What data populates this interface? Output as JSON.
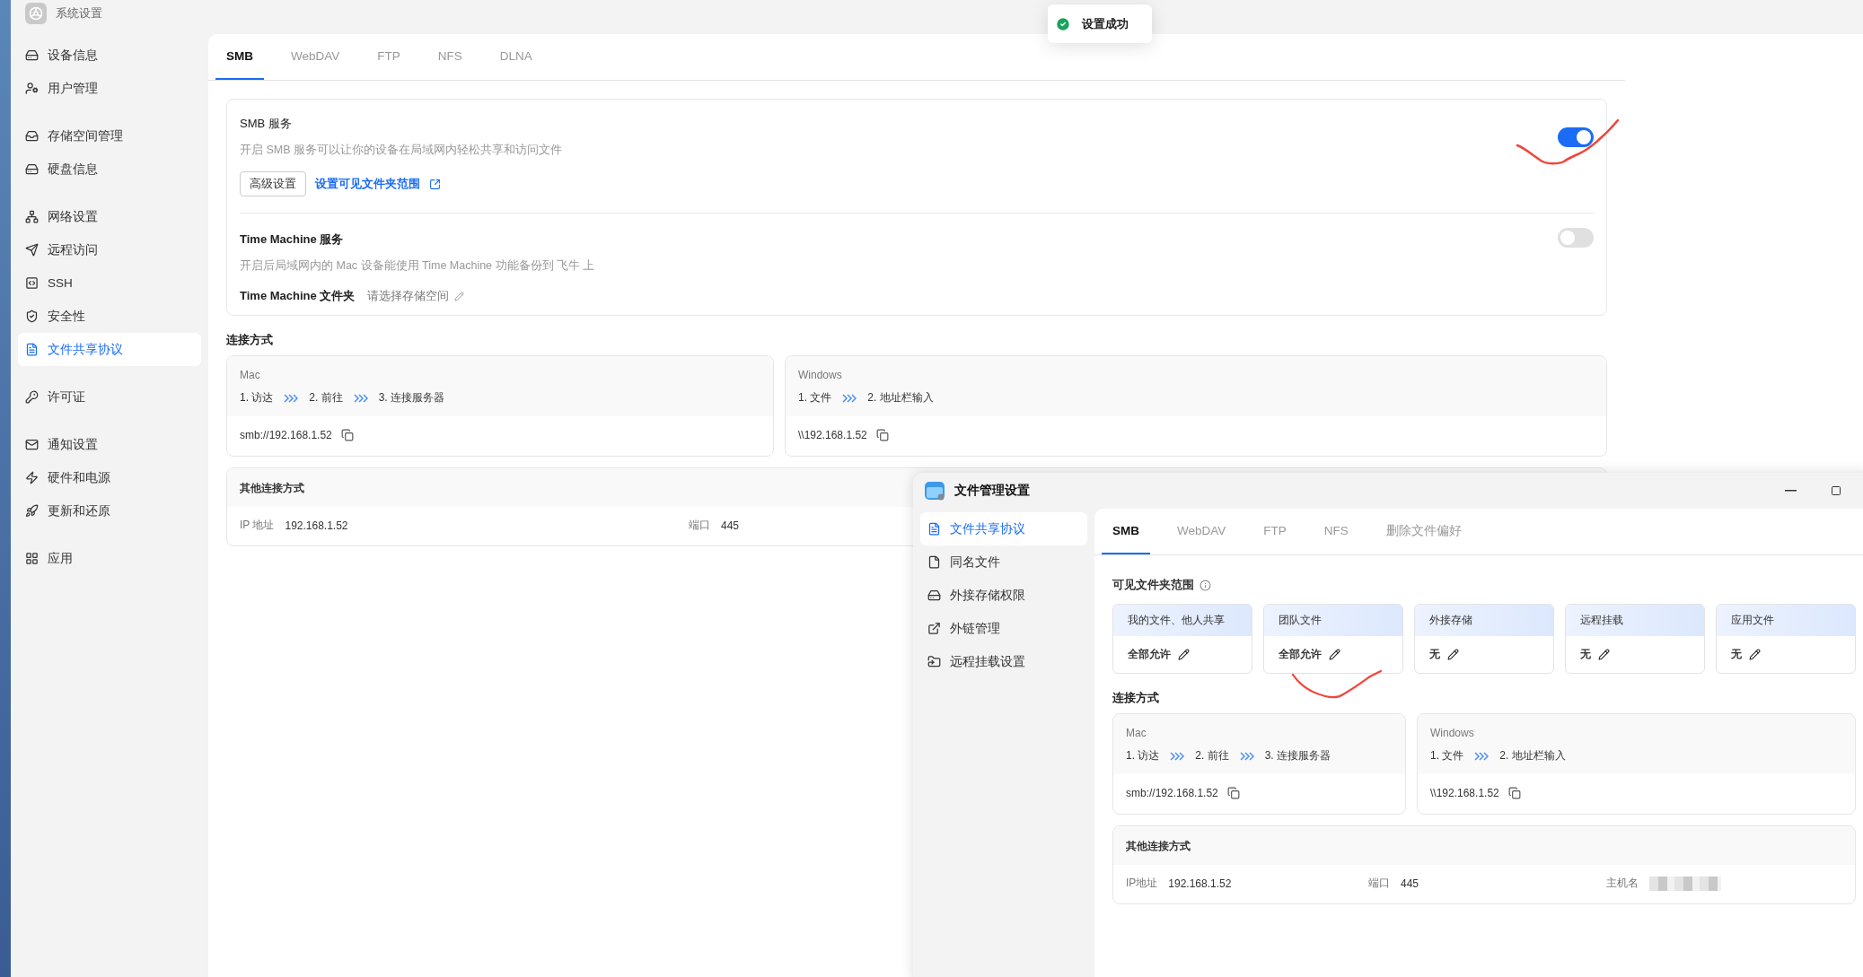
{
  "app_title": "系统设置",
  "sidebar": {
    "groups": [
      [
        {
          "label": "设备信息",
          "selected": false
        },
        {
          "label": "用户管理",
          "selected": false
        }
      ],
      [
        {
          "label": "存储空间管理",
          "selected": false
        },
        {
          "label": "硬盘信息",
          "selected": false
        }
      ],
      [
        {
          "label": "网络设置",
          "selected": false
        },
        {
          "label": "远程访问",
          "selected": false
        },
        {
          "label": "SSH",
          "selected": false
        },
        {
          "label": "安全性",
          "selected": false
        },
        {
          "label": "文件共享协议",
          "selected": true
        }
      ],
      [
        {
          "label": "许可证",
          "selected": false
        }
      ],
      [
        {
          "label": "通知设置",
          "selected": false
        },
        {
          "label": "硬件和电源",
          "selected": false
        },
        {
          "label": "更新和还原",
          "selected": false
        }
      ],
      [
        {
          "label": "应用",
          "selected": false
        }
      ]
    ]
  },
  "tabs": [
    {
      "label": "SMB",
      "selected": true
    },
    {
      "label": "WebDAV",
      "selected": false
    },
    {
      "label": "FTP",
      "selected": false
    },
    {
      "label": "NFS",
      "selected": false
    },
    {
      "label": "DLNA",
      "selected": false
    }
  ],
  "smb_service": {
    "title": "SMB 服务",
    "description": "开启 SMB 服务可以让你的设备在局域网内轻松共享和访问文件",
    "on": true,
    "advanced_button": "高级设置",
    "link": "设置可见文件夹范围"
  },
  "time_machine": {
    "title": "Time Machine 服务",
    "description": "开启后局域网内的 Mac 设备能使用 Time Machine 功能备份到 飞牛 上",
    "on": false,
    "folder_label": "Time Machine 文件夹",
    "folder_value": "请选择存储空间"
  },
  "connection": {
    "heading": "连接方式",
    "methods": [
      {
        "title": "Mac",
        "steps": [
          "1. 访达",
          "2. 前往",
          "3. 连接服务器"
        ],
        "address": "smb://192.168.1.52"
      },
      {
        "title": "Windows",
        "steps": [
          "1. 文件",
          "2. 地址栏输入"
        ],
        "address": "\\\\192.168.1.52"
      }
    ]
  },
  "other": {
    "heading": "其他连接方式",
    "fields": [
      {
        "label": "IP 地址",
        "value": "192.168.1.52"
      },
      {
        "label": "端口",
        "value": "445"
      }
    ]
  },
  "toast": {
    "message": "设置成功"
  },
  "overlay": {
    "title": "文件管理设置",
    "sidebar": [
      {
        "label": "文件共享协议",
        "selected": true
      },
      {
        "label": "同名文件",
        "selected": false
      },
      {
        "label": "外接存储权限",
        "selected": false
      },
      {
        "label": "外链管理",
        "selected": false
      },
      {
        "label": "远程挂载设置",
        "selected": false
      }
    ],
    "tabs": [
      {
        "label": "SMB",
        "selected": true
      },
      {
        "label": "WebDAV",
        "selected": false
      },
      {
        "label": "FTP",
        "selected": false
      },
      {
        "label": "NFS",
        "selected": false
      },
      {
        "label": "删除文件偏好",
        "selected": false
      }
    ],
    "scope": {
      "heading": "可见文件夹范围",
      "cards": [
        {
          "title": "我的文件、他人共享",
          "value": "全部允许"
        },
        {
          "title": "团队文件",
          "value": "全部允许"
        },
        {
          "title": "外接存储",
          "value": "无"
        },
        {
          "title": "远程挂载",
          "value": "无"
        },
        {
          "title": "应用文件",
          "value": "无"
        }
      ]
    },
    "connection": {
      "heading": "连接方式",
      "methods": [
        {
          "title": "Mac",
          "steps": [
            "1. 访达",
            "2. 前往",
            "3. 连接服务器"
          ],
          "address": "smb://192.168.1.52"
        },
        {
          "title": "Windows",
          "steps": [
            "1. 文件",
            "2. 地址栏输入"
          ],
          "address": "\\\\192.168.1.52"
        }
      ]
    },
    "other": {
      "heading": "其他连接方式",
      "fields": [
        {
          "label": "IP地址",
          "value": "192.168.1.52",
          "redacted": false
        },
        {
          "label": "端口",
          "value": "445",
          "redacted": false
        },
        {
          "label": "主机名",
          "redacted": true
        }
      ]
    }
  }
}
